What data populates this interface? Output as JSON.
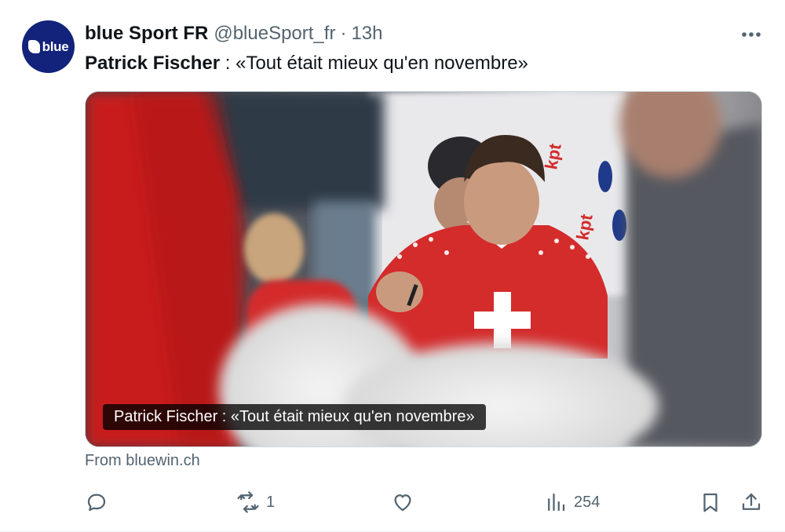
{
  "tweet": {
    "display_name": "blue Sport FR",
    "handle": "@blueSport_fr",
    "separator": "·",
    "time": "13h",
    "avatar_text": "blue",
    "text_bold": "Patrick Fischer",
    "text_rest": " : «Tout était mieux qu'en novembre»"
  },
  "card": {
    "caption": "Patrick Fischer : «Tout était mieux qu'en novembre»",
    "source": "From bluewin.ch"
  },
  "actions": {
    "reply_count": "",
    "retweet_count": "1",
    "like_count": "",
    "views_count": "254"
  },
  "icons": [
    "more-icon",
    "reply-icon",
    "retweet-icon",
    "like-icon",
    "views-icon",
    "bookmark-icon",
    "share-icon"
  ],
  "colors": {
    "text_primary": "#0f1419",
    "text_secondary": "#536471",
    "avatar_bg": "#13227a",
    "jersey_red": "#d42b2b"
  }
}
